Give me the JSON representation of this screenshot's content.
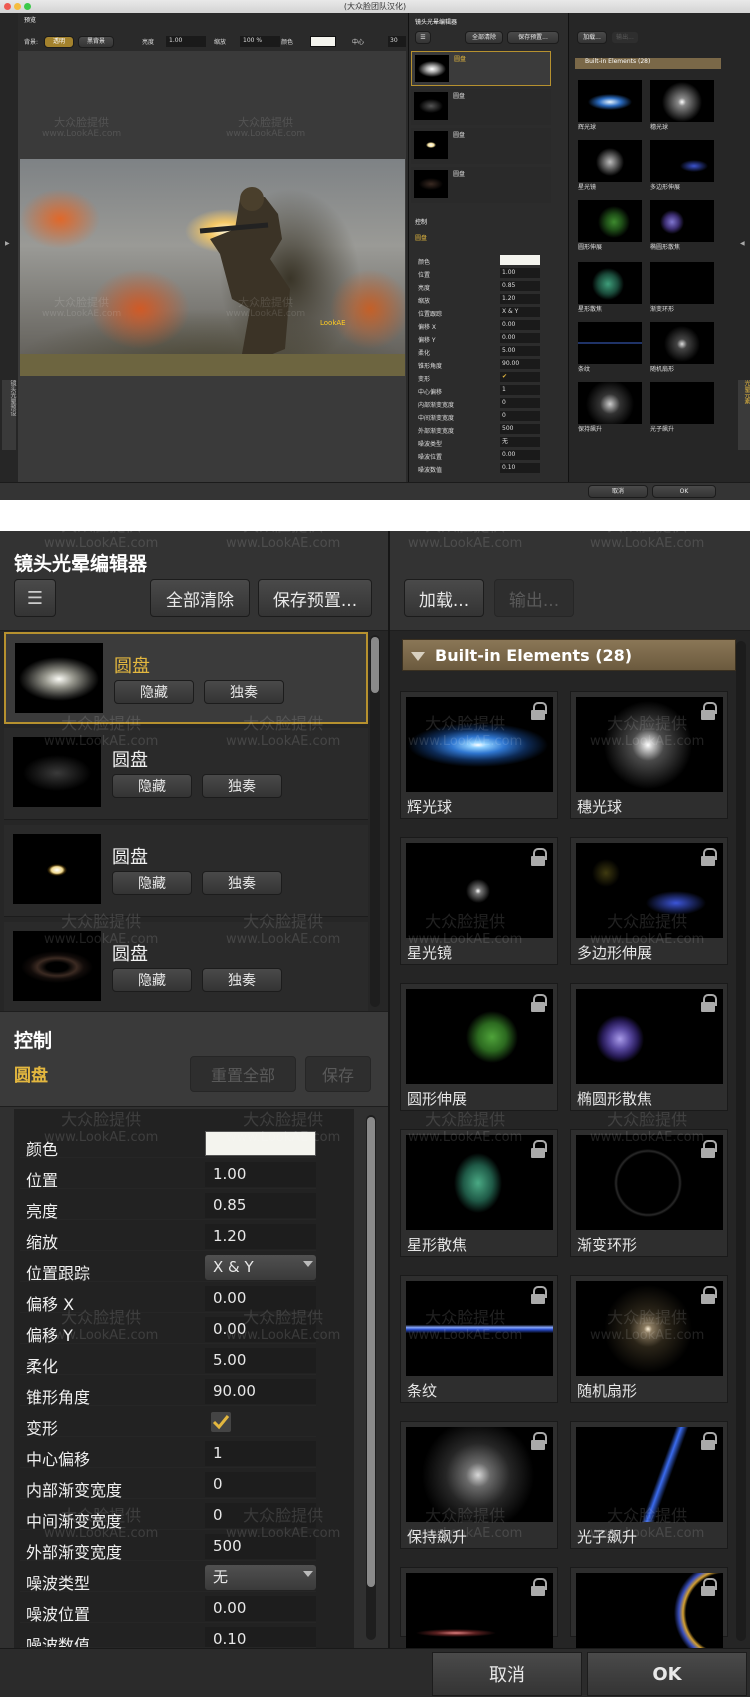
{
  "window": {
    "title": "(大众脸团队汉化)"
  },
  "watermark": {
    "text": "大众脸提供",
    "url": "www.LookAE.com"
  },
  "preview": {
    "title": "预览",
    "bg_label": "背景:",
    "bg_btn1": "透明",
    "bg_btn2": "黑背景",
    "brightness_label": "亮度",
    "brightness_value": "1.00",
    "scale_label": "缩放",
    "scale_value": "100 %",
    "color_label": "颜色",
    "center_label": "中心",
    "center_value": "30",
    "photo_caption": "LookAE",
    "left_tab": "镜头光晕预设",
    "right_tab": "光晕元素"
  },
  "editor": {
    "title": "镜头光晕编辑器",
    "clear_all": "全部清除",
    "save_preset": "保存预置...",
    "layers": [
      {
        "name": "圆盘",
        "hide": "隐藏",
        "solo": "独奏",
        "selected": true
      },
      {
        "name": "圆盘",
        "hide": "隐藏",
        "solo": "独奏",
        "selected": false
      },
      {
        "name": "圆盘",
        "hide": "隐藏",
        "solo": "独奏",
        "selected": false
      },
      {
        "name": "圆盘",
        "hide": "隐藏",
        "solo": "独奏",
        "selected": false
      }
    ]
  },
  "control": {
    "title": "控制",
    "element": "圆盘",
    "reset_all": "重置全部",
    "save": "保存",
    "rows": [
      {
        "label": "颜色",
        "value": ""
      },
      {
        "label": "位置",
        "value": "1.00"
      },
      {
        "label": "亮度",
        "value": "0.85"
      },
      {
        "label": "缩放",
        "value": "1.20"
      },
      {
        "label": "位置跟踪",
        "value": "X & Y"
      },
      {
        "label": "偏移 X",
        "value": "0.00"
      },
      {
        "label": "偏移 Y",
        "value": "0.00"
      },
      {
        "label": "柔化",
        "value": "5.00"
      },
      {
        "label": "锥形角度",
        "value": "90.00"
      },
      {
        "label": "变形",
        "value": ""
      },
      {
        "label": "中心偏移",
        "value": "1"
      },
      {
        "label": "内部渐变宽度",
        "value": "0"
      },
      {
        "label": "中间渐变宽度",
        "value": "0"
      },
      {
        "label": "外部渐变宽度",
        "value": "500"
      },
      {
        "label": "噪波类型",
        "value": "无"
      },
      {
        "label": "噪波位置",
        "value": "0.00"
      },
      {
        "label": "噪波数值",
        "value": "0.10"
      }
    ],
    "color_swatch": "#f4f4ee",
    "distort_checked": true
  },
  "library": {
    "load": "加载...",
    "export": "输出...",
    "section": "Built-in Elements (28)",
    "elements": [
      {
        "name": "辉光球",
        "icon": "glow-ball"
      },
      {
        "name": "穗光球",
        "icon": "spike-ball"
      },
      {
        "name": "星光镜",
        "icon": "star-filter"
      },
      {
        "name": "多边形伸展",
        "icon": "poly-spread"
      },
      {
        "name": "圆形伸展",
        "icon": "circle-spread"
      },
      {
        "name": "椭圆形散焦",
        "icon": "ellipse-bokeh"
      },
      {
        "name": "星形散焦",
        "icon": "star-bokeh"
      },
      {
        "name": "渐变环形",
        "icon": "gradient-ring"
      },
      {
        "name": "条纹",
        "icon": "streak"
      },
      {
        "name": "随机扇形",
        "icon": "random-fan"
      },
      {
        "name": "保持飙升",
        "icon": "hold-rise"
      },
      {
        "name": "光子飙升",
        "icon": "photon-rise"
      },
      {
        "name": "",
        "icon": "partial-1"
      },
      {
        "name": "",
        "icon": "partial-2"
      }
    ]
  },
  "footer": {
    "cancel": "取消",
    "ok": "OK"
  }
}
